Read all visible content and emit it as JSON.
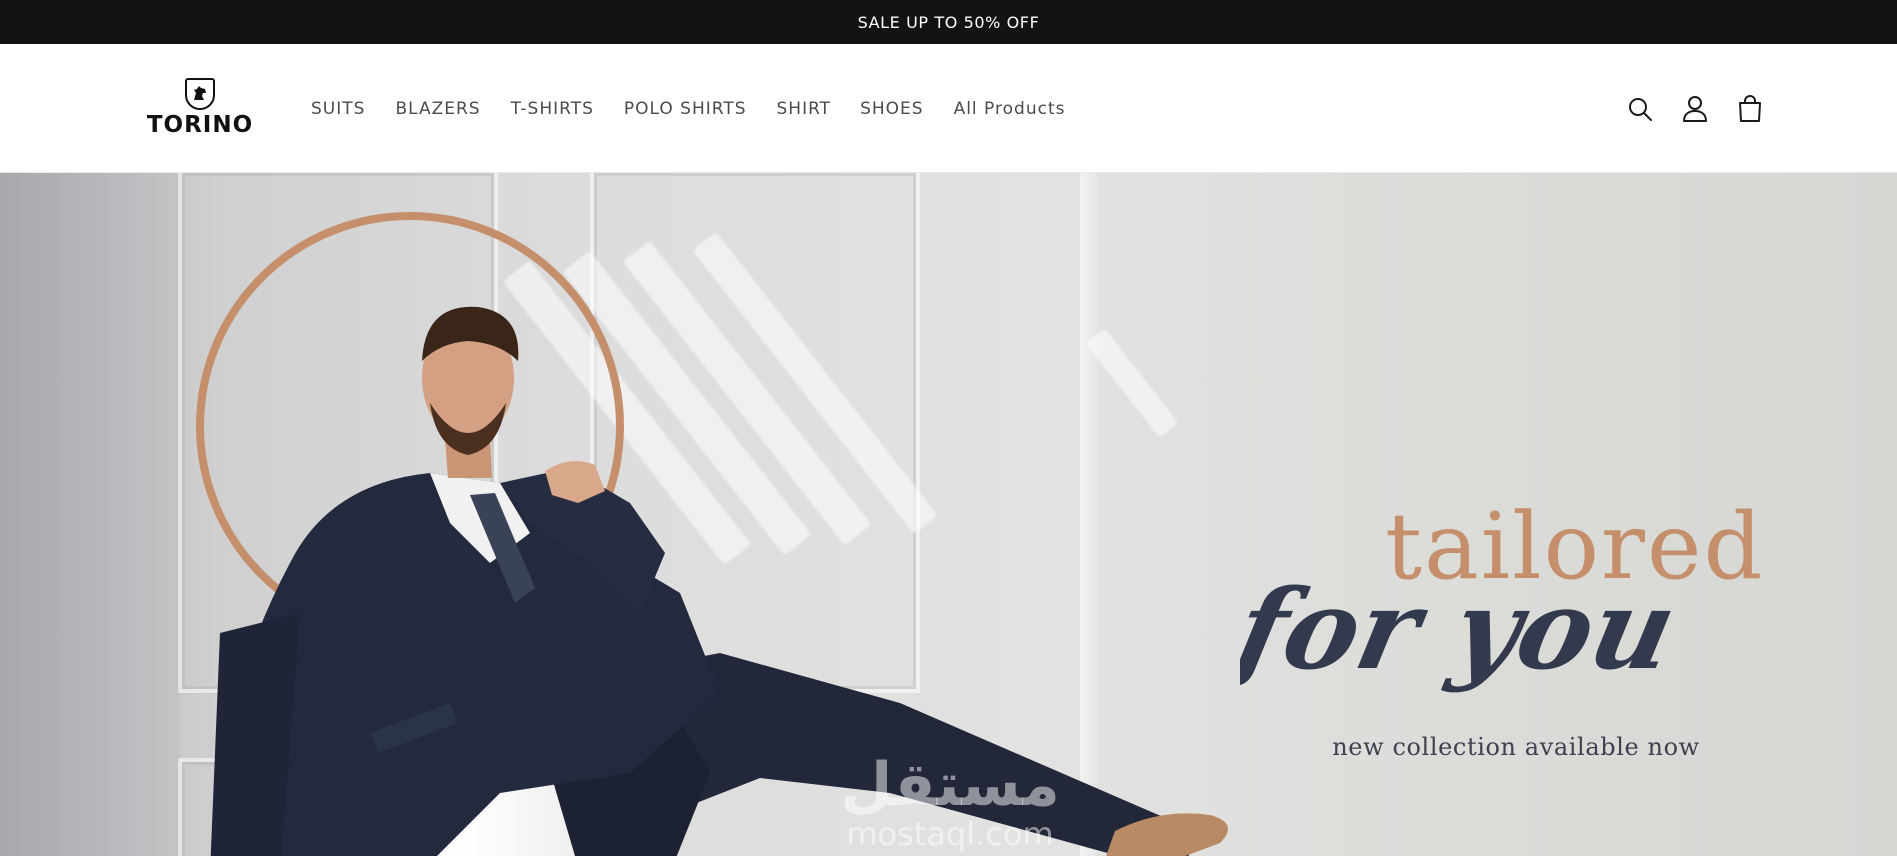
{
  "announcement": {
    "text": "SALE UP TO 50% OFF"
  },
  "header": {
    "logo_text": "TORINO",
    "nav": [
      "SUITS",
      "BLAZERS",
      "T-SHIRTS",
      "POLO SHIRTS",
      "SHIRT",
      "SHOES",
      "All Products"
    ],
    "icons": [
      "search-icon",
      "account-icon",
      "cart-icon"
    ]
  },
  "hero": {
    "headline_top": "tailored",
    "headline_script": "for you",
    "subtitle": "new collection available now",
    "watermark_arabic": "مستقل",
    "watermark_latin": "mostaql.com",
    "colors": {
      "accent": "#c58f6b",
      "navy": "#343a4e"
    }
  }
}
